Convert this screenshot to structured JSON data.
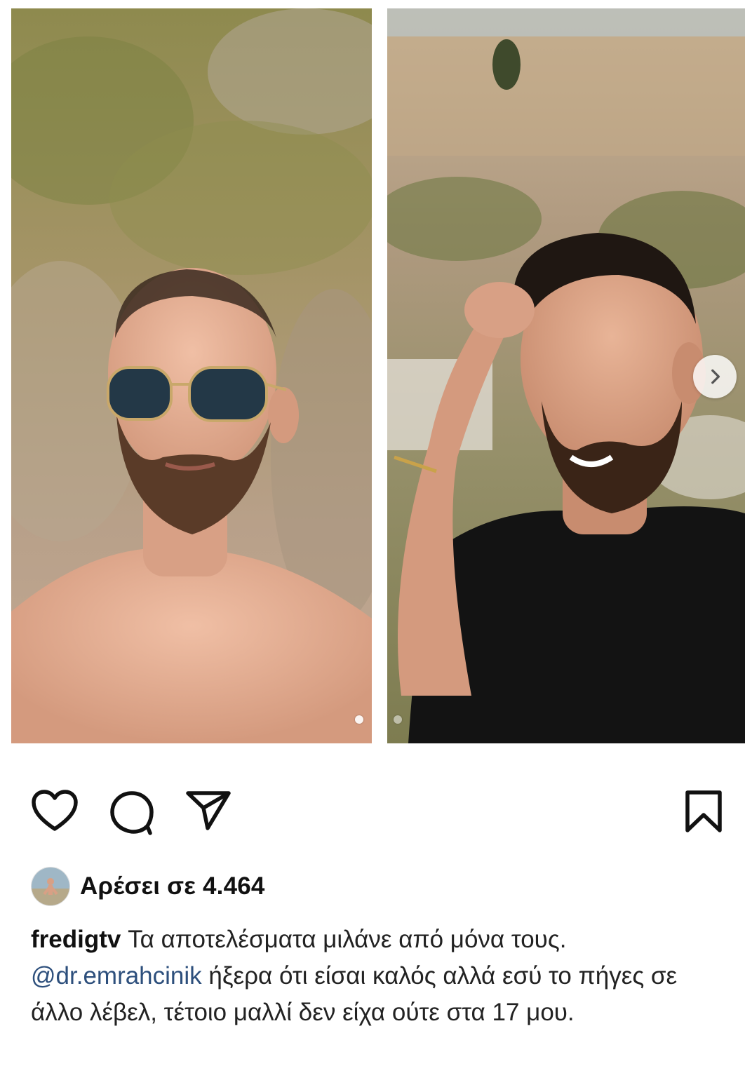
{
  "post": {
    "carousel": {
      "slides": [
        {
          "alt": "before"
        },
        {
          "alt": "after"
        }
      ],
      "next_icon": "chevron-right-icon"
    },
    "actions": {
      "like_icon": "heart-icon",
      "comment_icon": "comment-icon",
      "share_icon": "paper-plane-icon",
      "save_icon": "bookmark-icon"
    },
    "likes": {
      "text": "Αρέσει σε 4.464"
    },
    "caption": {
      "username": "fredigtv",
      "line1": " Τα αποτελέσματα μιλάνε από μόνα τους.",
      "mention": "@dr.emrahcinik",
      "rest": " ήξερα ότι είσαι καλός αλλά εσύ το πήγες σε άλλο λέβελ, τέτοιο μαλλί δεν είχα ούτε στα 17 μου."
    }
  }
}
